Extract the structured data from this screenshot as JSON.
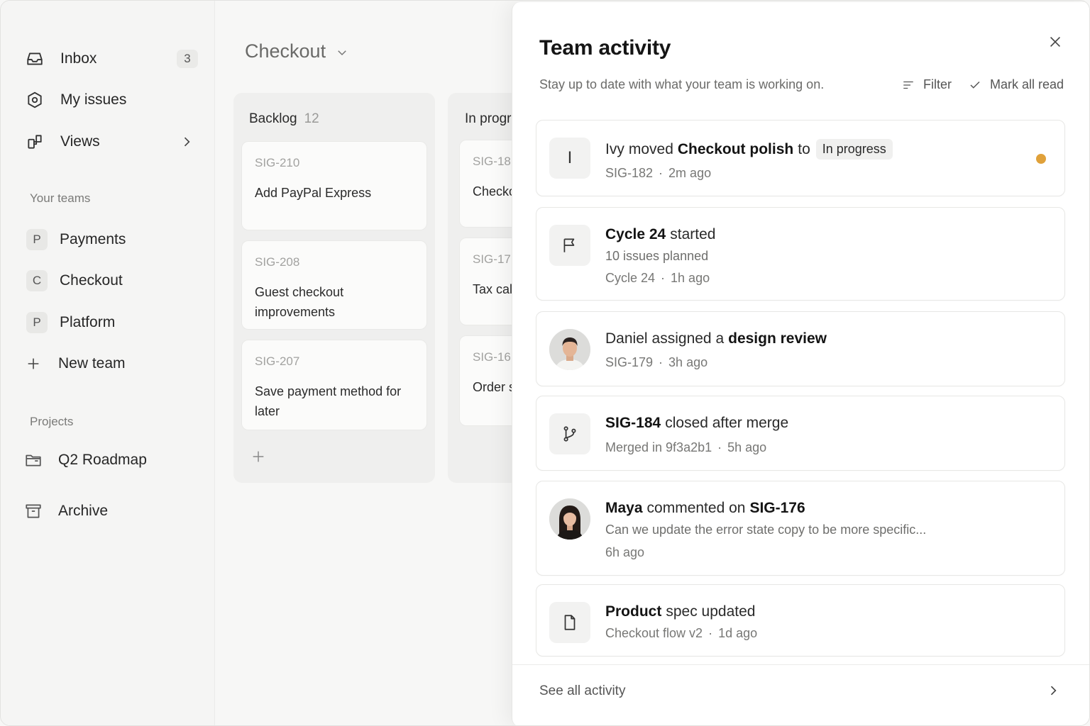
{
  "colors": {
    "accent_unread": "#e0a13a",
    "text_primary": "#1c1c1c",
    "text_muted": "#777775"
  },
  "sidebar": {
    "items": [
      {
        "label": "Inbox",
        "icon": "inbox-icon",
        "count": "3"
      },
      {
        "label": "My issues",
        "icon": "target-icon"
      },
      {
        "label": "Views",
        "icon": "views-icon"
      }
    ],
    "teams_label": "Your teams",
    "teams": [
      {
        "initial": "P",
        "label": "Payments"
      },
      {
        "initial": "C",
        "label": "Checkout"
      },
      {
        "initial": "P",
        "label": "Platform"
      }
    ],
    "new_team_label": "New team",
    "projects_label": "Projects",
    "projects": [
      {
        "label": "Q2 Roadmap",
        "icon": "folder-icon"
      }
    ],
    "archive_label": "Archive"
  },
  "board": {
    "title": "Checkout",
    "columns": [
      {
        "name": "Backlog",
        "count": "12",
        "cards": [
          {
            "id": "SIG-210",
            "title": "Add PayPal Express"
          },
          {
            "id": "SIG-208",
            "title": "Guest checkout improvements"
          },
          {
            "id": "SIG-207",
            "title": "Save payment method for later"
          }
        ]
      },
      {
        "name": "In progr",
        "cards": [
          {
            "id": "SIG-18",
            "title": "Checko"
          },
          {
            "id": "SIG-17",
            "title": "Tax cal"
          },
          {
            "id": "SIG-16",
            "title": "Order s"
          }
        ]
      }
    ]
  },
  "panel": {
    "title": "Team activity",
    "subtitle": "Stay up to date with what your team is working on.",
    "filter_label": "Filter",
    "mark_read_label": "Mark all read",
    "activities": [
      {
        "avatar_initial": "I",
        "actor": "Ivy",
        "verb": "moved",
        "object": "Checkout polish",
        "preposition": "to",
        "status_pill": "In progress",
        "ref": "SIG-182",
        "time": "2m ago",
        "unread": true
      },
      {
        "icon": "flag-icon",
        "subject": "Cycle 24",
        "verb": "started",
        "detail": "10 issues planned",
        "ref": "Cycle 24",
        "time": "1h ago"
      },
      {
        "actor": "Daniel",
        "verb": "assigned a",
        "object": "design review",
        "ref": "SIG-179",
        "time": "3h ago"
      },
      {
        "icon": "git-branch-icon",
        "subject": "SIG-184",
        "verb": "closed after merge",
        "ref": "Merged in 9f3a2b1",
        "time": "5h ago"
      },
      {
        "actor": "Maya",
        "verb": "commented on",
        "object": "SIG-176",
        "comment": "Can we update the error state copy to be more specific...",
        "time": "6h ago"
      },
      {
        "icon": "document-icon",
        "subject": "Product",
        "verb": "spec updated",
        "ref": "Checkout flow v2",
        "time": "1d ago"
      }
    ],
    "see_all_label": "See all activity"
  }
}
